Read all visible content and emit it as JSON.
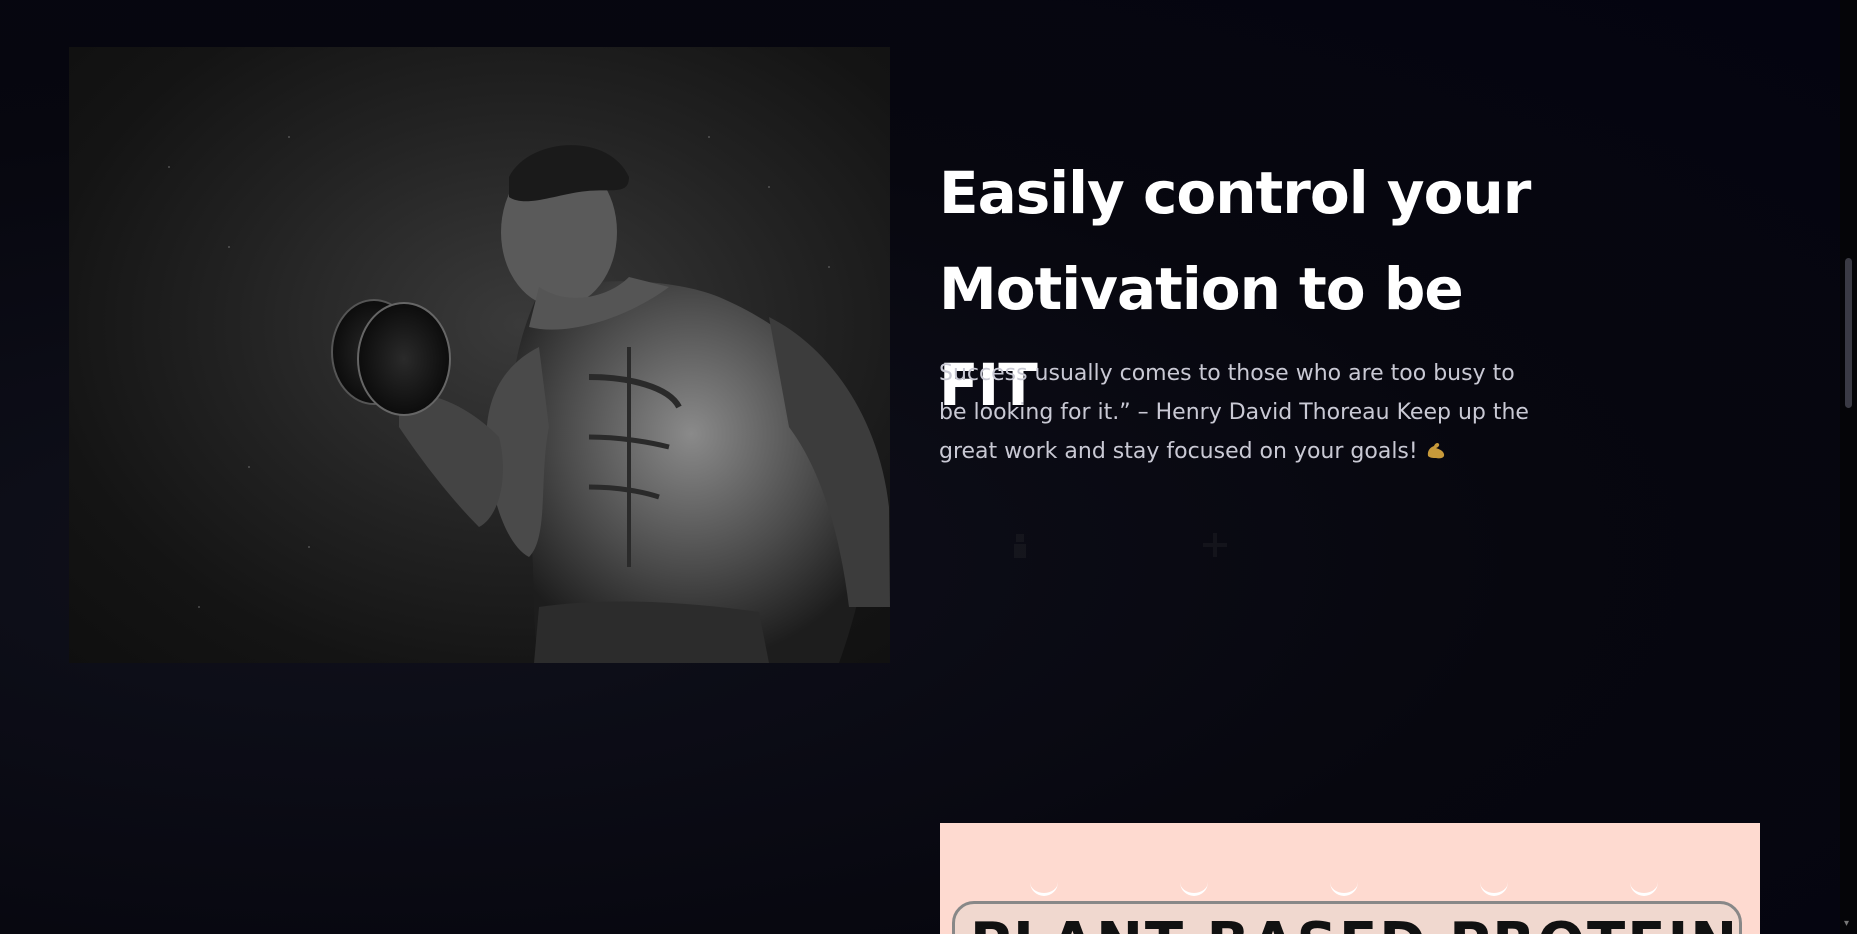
{
  "hero": {
    "image_alt": "muscular man lifting dumbbell",
    "headline_line1": "Easily control your",
    "headline_line2": "Motivation to be FIT",
    "quote": "Success usually comes to those who are too busy to be looking for it.” – Henry David Thoreau Keep up the great work and stay focused on your goals!",
    "emoji": "flexed-biceps-icon"
  },
  "icons": [
    "person-icon",
    "move-icon"
  ],
  "product": {
    "title": "PLANT BASED PROTEIN"
  },
  "colors": {
    "background": "#07070f",
    "headline": "#ffffff",
    "body_text": "#c9c9d4",
    "product_bg": "#fedad0"
  }
}
